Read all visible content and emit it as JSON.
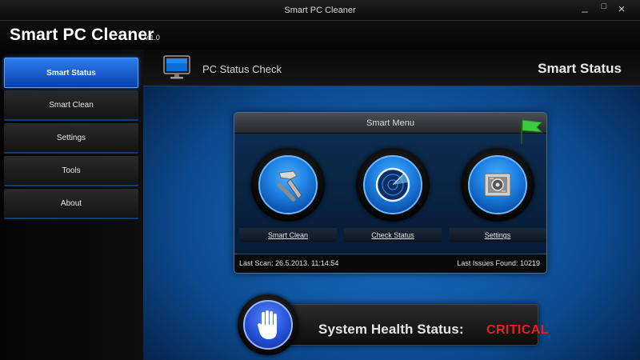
{
  "window": {
    "title": "Smart PC Cleaner",
    "controls": {
      "minimize": "_",
      "maximize": "□",
      "close": "×"
    }
  },
  "app": {
    "name": "Smart PC Cleaner",
    "version": "v.1.0"
  },
  "sidebar": {
    "items": [
      {
        "label": "Smart Status",
        "active": true
      },
      {
        "label": "Smart Clean",
        "active": false
      },
      {
        "label": "Settings",
        "active": false
      },
      {
        "label": "Tools",
        "active": false
      },
      {
        "label": "About",
        "active": false
      }
    ]
  },
  "main": {
    "section_title": "PC Status Check",
    "section_heading": "Smart Status",
    "section_icon": "monitor-icon"
  },
  "smart_menu": {
    "title": "Smart Menu",
    "flag_icon": "green-flag-icon",
    "items": [
      {
        "label": "Smart Clean",
        "icon": "hammer-icon"
      },
      {
        "label": "Check Status",
        "icon": "radar-icon"
      },
      {
        "label": "Settings",
        "icon": "settings-panel-icon"
      }
    ],
    "last_scan": "Last Scan: 26.5.2013. 11:14:54",
    "last_issues": "Last Issues Found: 10219"
  },
  "health": {
    "label": "System Health Status:",
    "value": "CRITICAL",
    "icon": "stop-hand-icon",
    "value_color": "#e0241c"
  },
  "colors": {
    "accent": "#1c7ee0",
    "active_nav": "#2d7cf0",
    "background": "#0c4a8f"
  }
}
